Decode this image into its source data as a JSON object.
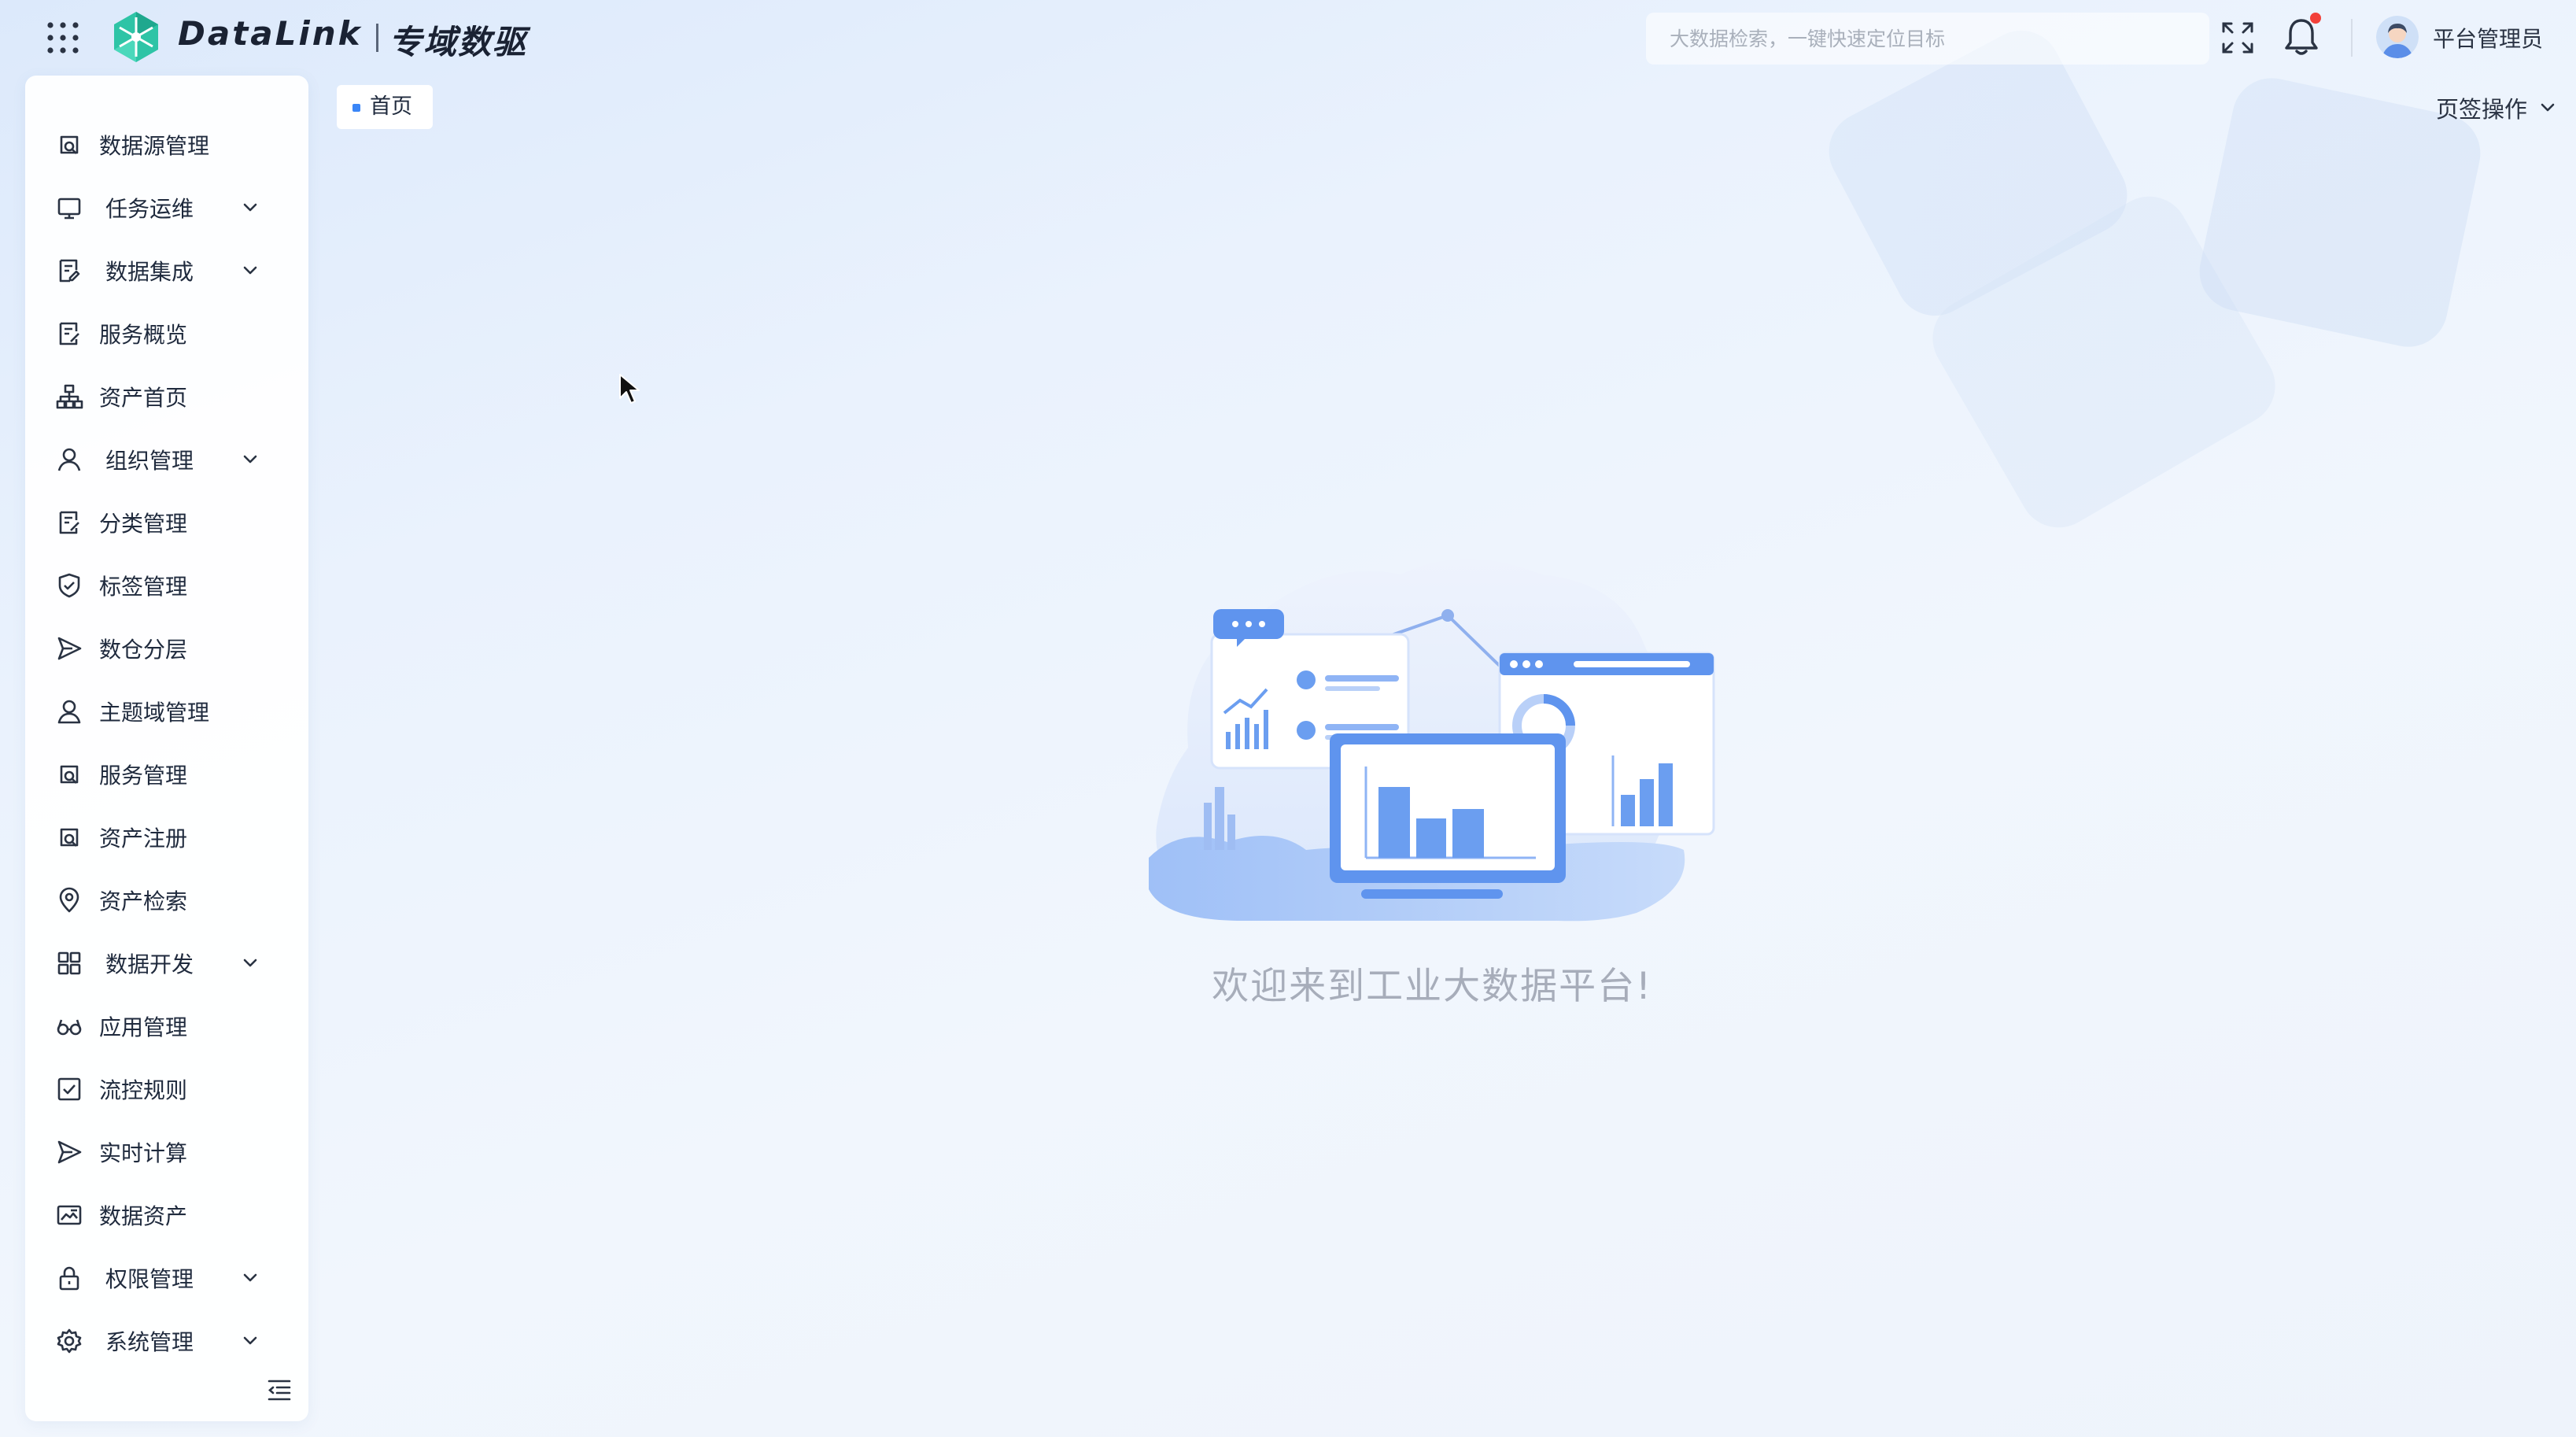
{
  "header": {
    "brand": "DataLink",
    "brand_sub": "专域数驱",
    "search_placeholder": "大数据检索，一键快速定位目标",
    "user_name": "平台管理员"
  },
  "sidebar": {
    "items": [
      {
        "label": "数据源管理",
        "icon": "datasource-icon",
        "expandable": false
      },
      {
        "label": "任务运维",
        "icon": "monitor-icon",
        "expandable": true
      },
      {
        "label": "数据集成",
        "icon": "integration-icon",
        "expandable": true
      },
      {
        "label": "服务概览",
        "icon": "edit-doc-icon",
        "expandable": false
      },
      {
        "label": "资产首页",
        "icon": "hierarchy-icon",
        "expandable": false
      },
      {
        "label": "组织管理",
        "icon": "user-icon",
        "expandable": true
      },
      {
        "label": "分类管理",
        "icon": "edit-doc-icon",
        "expandable": false
      },
      {
        "label": "标签管理",
        "icon": "shield-check-icon",
        "expandable": false
      },
      {
        "label": "数仓分层",
        "icon": "send-icon",
        "expandable": false
      },
      {
        "label": "主题域管理",
        "icon": "user-icon",
        "expandable": false
      },
      {
        "label": "服务管理",
        "icon": "datasource-icon",
        "expandable": false
      },
      {
        "label": "资产注册",
        "icon": "datasource-icon",
        "expandable": false
      },
      {
        "label": "资产检索",
        "icon": "location-icon",
        "expandable": false
      },
      {
        "label": "数据开发",
        "icon": "grid-icon",
        "expandable": true
      },
      {
        "label": "应用管理",
        "icon": "glasses-icon",
        "expandable": false
      },
      {
        "label": "流控规则",
        "icon": "checkbox-icon",
        "expandable": false
      },
      {
        "label": "实时计算",
        "icon": "send-icon",
        "expandable": false
      },
      {
        "label": "数据资产",
        "icon": "image-card-icon",
        "expandable": false
      },
      {
        "label": "权限管理",
        "icon": "lock-icon",
        "expandable": true
      },
      {
        "label": "系统管理",
        "icon": "gear-icon",
        "expandable": true
      }
    ]
  },
  "tabs": {
    "home_label": "首页",
    "page_ops_label": "页签操作"
  },
  "main": {
    "welcome_text": "欢迎来到工业大数据平台!"
  },
  "colors": {
    "accent": "#3a86f7",
    "illustration_blue": "#8fb4f5",
    "notification_dot": "#f2403a"
  }
}
